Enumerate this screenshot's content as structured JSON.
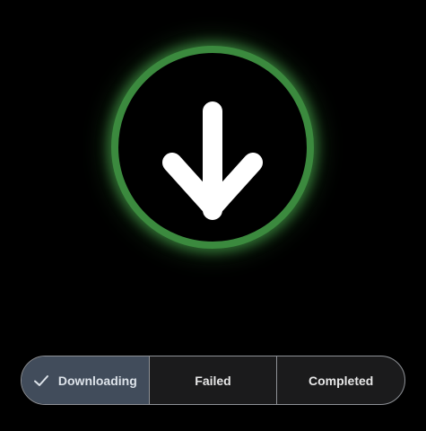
{
  "colors": {
    "background": "#000000",
    "ring": "#3b8a3e",
    "ring_glow": "#4caf50",
    "arrow": "#ffffff",
    "segment_selected_bg": "#414c5b",
    "segment_bg": "#1b1b1c",
    "segment_border": "#8e9196"
  },
  "status_indicator": {
    "icon": "download-arrow-icon",
    "state": "downloading"
  },
  "segmented_control": {
    "selected_index": 0,
    "segments": [
      {
        "label": "Downloading",
        "icon": "check-icon",
        "selected": true
      },
      {
        "label": "Failed",
        "selected": false
      },
      {
        "label": "Completed",
        "selected": false
      }
    ]
  }
}
